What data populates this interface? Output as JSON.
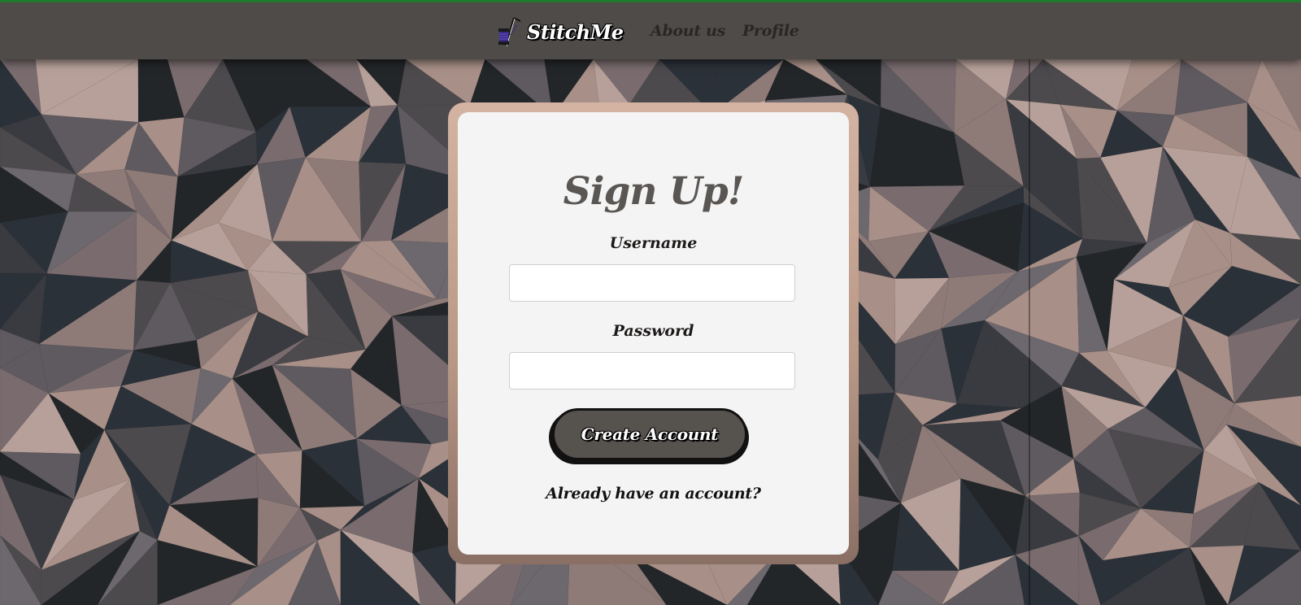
{
  "colors": {
    "top_accent": "#1f7a2c",
    "navbar": "#4e4b48",
    "card": "#f4f4f4",
    "card_frame": "#c9a898",
    "title": "#5a5653",
    "button": "#56524e",
    "button_text": "#ffffff"
  },
  "navbar": {
    "brand_icon": "thread-spool-needle-icon",
    "brand_name": "StitchMe",
    "links": [
      {
        "label": "About us"
      },
      {
        "label": "Profile"
      }
    ]
  },
  "background": {
    "style": "low-poly geometric pattern",
    "palette": [
      "#2b3139",
      "#3a3b40",
      "#4d4a4e",
      "#5f5a60",
      "#7a6c6e",
      "#8e7b78",
      "#a89088",
      "#b7a09a",
      "#232629",
      "#6d686e"
    ]
  },
  "signup": {
    "title": "Sign Up!",
    "username_label": "Username",
    "username_value": "",
    "username_placeholder": "",
    "password_label": "Password",
    "password_value": "",
    "password_placeholder": "",
    "submit_label": "Create Account",
    "login_link": "Already have an account?"
  }
}
